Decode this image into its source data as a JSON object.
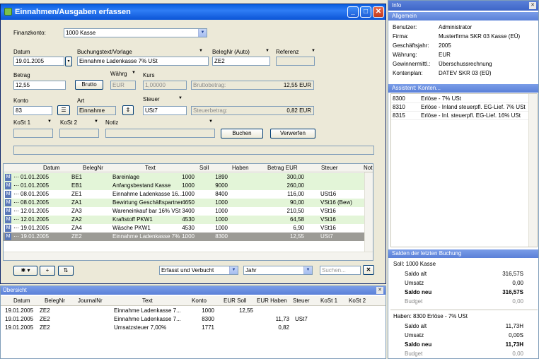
{
  "main_window": {
    "title": "Einnahmen/Ausgaben erfassen",
    "finanzkonto_label": "Finanzkonto:",
    "finanzkonto_value": "1000 Kasse",
    "datum_label": "Datum",
    "datum_value": "19.01.2005",
    "buchungstext_label": "Buchungstext/Vorlage",
    "buchungstext_value": "Einnahme Ladenkasse 7% USt",
    "belegnr_label": "BelegNr (Auto)",
    "belegnr_value": "ZE2",
    "referenz_label": "Referenz",
    "betrag_label": "Betrag",
    "betrag_value": "12,55",
    "brutto_button": "Brutto",
    "waehrung_label": "Währg",
    "waehrung_value": "EUR",
    "kurs_label": "Kurs",
    "kurs_value": "1,00000",
    "bruttobetrag_label": "Bruttobetrag:",
    "bruttobetrag_value": "12,55 EUR",
    "konto_label": "Konto",
    "konto_value": "83",
    "art_label": "Art",
    "art_value": "Einnahme",
    "steuer_label": "Steuer",
    "steuer_value": "USt7",
    "steuerbetrag_label": "Steuerbetrag:",
    "steuerbetrag_value": "0,82 EUR",
    "kost1_label": "KoSt 1",
    "kost2_label": "KoSt 2",
    "notiz_label": "Notiz",
    "buchen_button": "Buchen",
    "verwerfen_button": "Verwerfen"
  },
  "journal": {
    "columns": [
      "Datum",
      "BelegNr",
      "Text",
      "Soll",
      "Haben",
      "Betrag EUR",
      "Steuer",
      "Notiz"
    ],
    "rows": [
      {
        "mark": "M",
        "datum": "01.01.2005",
        "beleg": "BE1",
        "text": "Bareinlage",
        "soll": "1000",
        "haben": "1890",
        "betrag": "300,00",
        "steuer": "",
        "style": "green"
      },
      {
        "mark": "M",
        "datum": "01.01.2005",
        "beleg": "EB1",
        "text": "Anfangsbestand Kasse",
        "soll": "1000",
        "haben": "9000",
        "betrag": "260,00",
        "steuer": "",
        "style": "green"
      },
      {
        "mark": "M",
        "datum": "08.01.2005",
        "beleg": "ZE1",
        "text": "Einnahme Ladenkasse 16...",
        "soll": "1000",
        "haben": "8400",
        "betrag": "116,00",
        "steuer": "USt16",
        "style": "white"
      },
      {
        "mark": "M",
        "datum": "08.01.2005",
        "beleg": "ZA1",
        "text": "Bewirtung Geschäftspartner",
        "soll": "4650",
        "haben": "1000",
        "betrag": "90,00",
        "steuer": "VSt16 (Bew)",
        "style": "green"
      },
      {
        "mark": "M",
        "datum": "12.01.2005",
        "beleg": "ZA3",
        "text": "Wareneinkauf bar 16% VSt",
        "soll": "3400",
        "haben": "1000",
        "betrag": "210,50",
        "steuer": "VSt16",
        "style": "white"
      },
      {
        "mark": "M",
        "datum": "12.01.2005",
        "beleg": "ZA2",
        "text": "Kraftstoff PKW1",
        "soll": "4530",
        "haben": "1000",
        "betrag": "64,58",
        "steuer": "VSt16",
        "style": "green"
      },
      {
        "mark": "M",
        "datum": "19.01.2005",
        "beleg": "ZA4",
        "text": "Wäsche PKW1",
        "soll": "4530",
        "haben": "1000",
        "betrag": "6,90",
        "steuer": "VSt16",
        "style": "white"
      },
      {
        "mark": "M",
        "datum": "19.01.2005",
        "beleg": "ZE2",
        "text": "Einnahme Ladenkasse 7% ...",
        "soll": "1000",
        "haben": "8300",
        "betrag": "12,55",
        "steuer": "USt7",
        "style": "selected"
      }
    ],
    "filter_value": "Erfasst und Verbucht",
    "period_value": "Jahr",
    "search_placeholder": "Suchen..."
  },
  "uebersicht": {
    "title": "Übersicht",
    "columns": [
      "Datum",
      "BelegNr",
      "JournalNr",
      "Text",
      "Konto",
      "EUR Soll",
      "EUR Haben",
      "Steuer",
      "KoSt 1",
      "KoSt 2"
    ],
    "rows": [
      {
        "datum": "19.01.2005",
        "beleg": "ZE2",
        "journal": "",
        "text": "Einnahme Ladenkasse 7...",
        "konto": "1000",
        "soll": "12,55",
        "haben": "",
        "steuer": ""
      },
      {
        "datum": "19.01.2005",
        "beleg": "ZE2",
        "journal": "",
        "text": "Einnahme Ladenkasse 7...",
        "konto": "8300",
        "soll": "",
        "haben": "11,73",
        "steuer": "USt7"
      },
      {
        "datum": "19.01.2005",
        "beleg": "ZE2",
        "journal": "",
        "text": "Umsatzsteuer 7,00%",
        "konto": "1771",
        "soll": "",
        "haben": "0,82",
        "steuer": ""
      }
    ]
  },
  "info": {
    "title": "Info",
    "allgemein_header": "Allgemein",
    "allgemein": [
      {
        "label": "Benutzer:",
        "value": "Administrator"
      },
      {
        "label": "Firma:",
        "value": "Musterfirma SKR 03 Kasse (EÜ)"
      },
      {
        "label": "Geschäftsjahr:",
        "value": "2005"
      },
      {
        "label": "Währung:",
        "value": "EUR"
      },
      {
        "label": "Gewinnermittl.:",
        "value": "Überschussrechnung"
      },
      {
        "label": "Kontenplan:",
        "value": "DATEV SKR 03 (EÜ)"
      }
    ],
    "assistent_header": "Assistent: Konten...",
    "konten": [
      {
        "nr": "8300",
        "text": "Erlöse - 7% USt"
      },
      {
        "nr": "8310",
        "text": "Erlöse - Inland steuerpfl. EG-Lief. 7% USt"
      },
      {
        "nr": "8315",
        "text": "Erlöse - Inl. steuerpfl. EG-Lief. 16% USt"
      }
    ],
    "salden_header": "Salden der letzten Buchung",
    "soll_title": "Soll: 1000  Kasse",
    "soll_rows": [
      {
        "label": "Saldo alt",
        "value": "316,57S",
        "bold": false
      },
      {
        "label": "Umsatz",
        "value": "0,00",
        "bold": false
      },
      {
        "label": "Saldo neu",
        "value": "316,57S",
        "bold": true
      },
      {
        "label": "Budget",
        "value": "0,00",
        "bold": false
      }
    ],
    "haben_title": "Haben: 8300  Erlöse - 7% USt",
    "haben_rows": [
      {
        "label": "Saldo alt",
        "value": "11,73H",
        "bold": false
      },
      {
        "label": "Umsatz",
        "value": "0,00S",
        "bold": false
      },
      {
        "label": "Saldo neu",
        "value": "11,73H",
        "bold": true
      },
      {
        "label": "Budget",
        "value": "0,00",
        "bold": false
      }
    ]
  },
  "colors": {
    "row_green": "#e3f5d8",
    "row_selected": "#9c9b96",
    "title_blue": "#0a5ee0"
  }
}
